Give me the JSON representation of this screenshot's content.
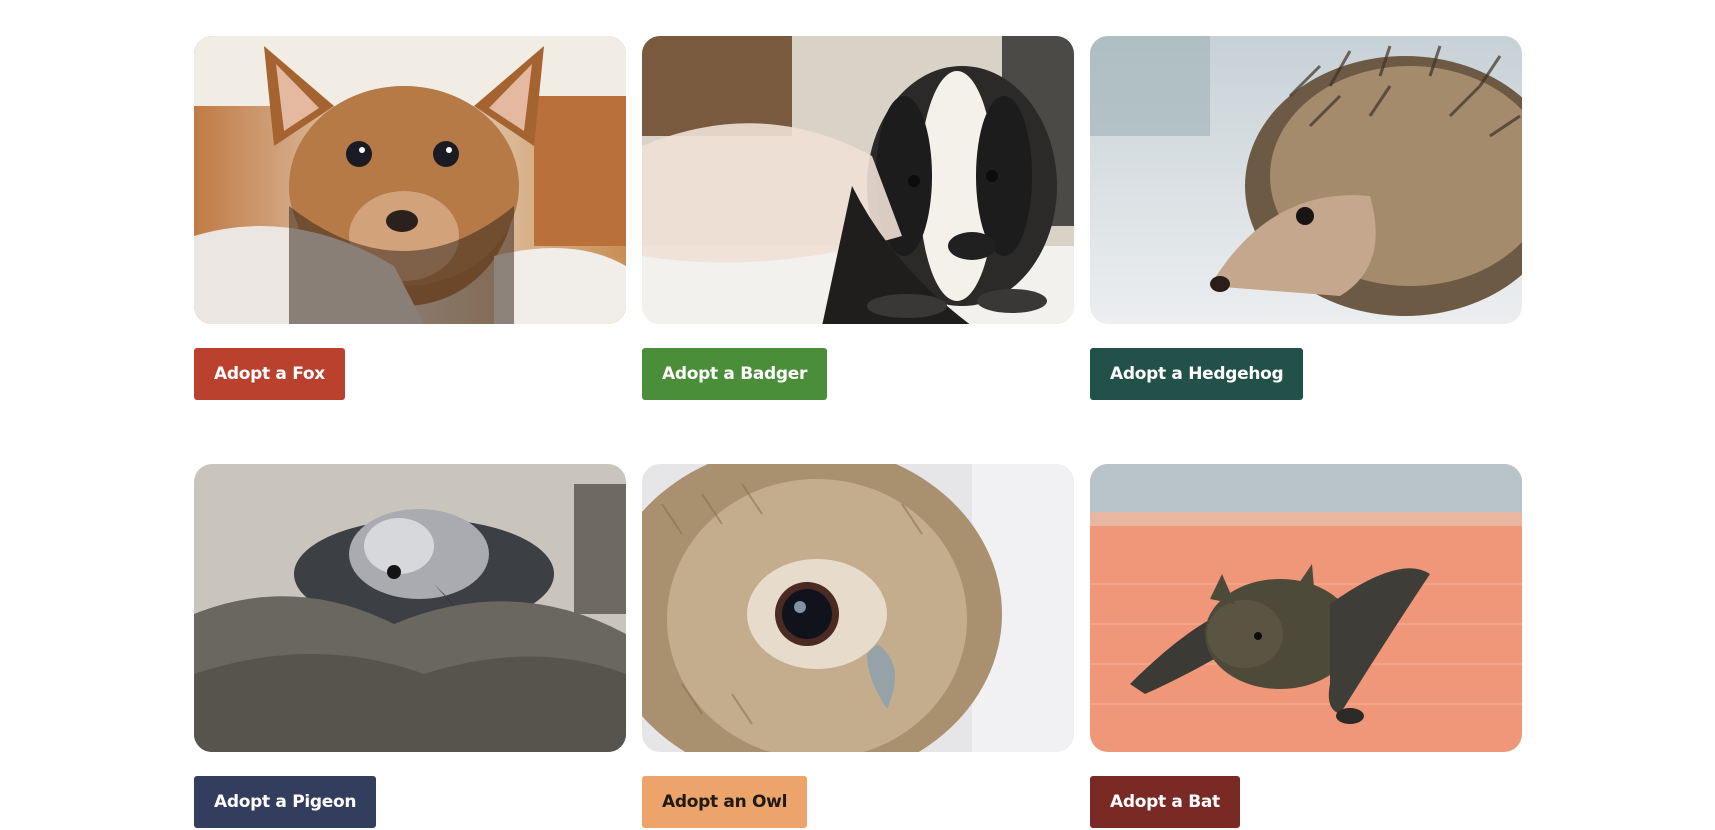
{
  "cards": [
    {
      "animal": "fox",
      "button_label": "Adopt a Fox",
      "button_color": "#b9412e",
      "image_description_icon": "fox-cub-photo"
    },
    {
      "animal": "badger",
      "button_label": "Adopt a Badger",
      "button_color": "#4b8e3a",
      "image_description_icon": "badger-cub-photo"
    },
    {
      "animal": "hedgehog",
      "button_label": "Adopt a Hedgehog",
      "button_color": "#22514a",
      "image_description_icon": "hedgehog-photo"
    },
    {
      "animal": "pigeon",
      "button_label": "Adopt a Pigeon",
      "button_color": "#333d5e",
      "image_description_icon": "pigeon-photo"
    },
    {
      "animal": "owl",
      "button_label": "Adopt an Owl",
      "button_color": "#eca46b",
      "image_description_icon": "owlet-photo"
    },
    {
      "animal": "bat",
      "button_label": "Adopt a Bat",
      "button_color": "#7a2a24",
      "image_description_icon": "bat-photo"
    }
  ]
}
